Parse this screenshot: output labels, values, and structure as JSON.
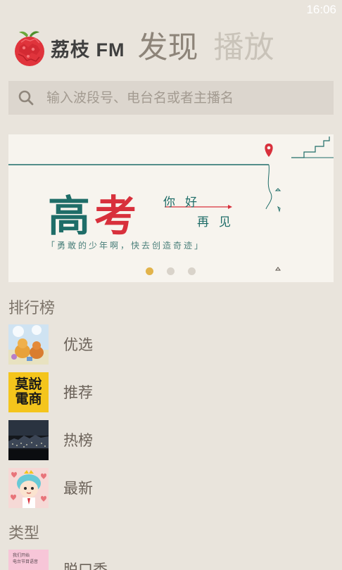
{
  "status_bar": {
    "time": "16:06"
  },
  "header": {
    "logo_text": "荔枝 FM",
    "tabs": [
      {
        "label": "发现",
        "active": true
      },
      {
        "label": "播放",
        "active": false
      }
    ]
  },
  "search": {
    "placeholder": "输入波段号、电台名或者主播名",
    "value": ""
  },
  "banner": {
    "title_part1": "高",
    "title_part2": "考",
    "greeting_line1": "你好",
    "greeting_line2": "再见",
    "motto": "「勇敢的少年啊，快去创造奇迹」",
    "page_count": 3,
    "active_page": 1
  },
  "ranking": {
    "title": "排行榜",
    "items": [
      {
        "label": "优选",
        "icon": "cartoon-bears-thumb"
      },
      {
        "label": "推荐",
        "icon": "yellow-text-thumb"
      },
      {
        "label": "热榜",
        "icon": "night-city-thumb"
      },
      {
        "label": "最新",
        "icon": "cartoon-boy-thumb"
      }
    ]
  },
  "categories": {
    "title": "类型",
    "items": [
      {
        "label": "脱口秀",
        "icon": "pink-card-thumb"
      }
    ]
  },
  "thumb_texts": {
    "yellow": "莫說電商",
    "pink_line1": "我们开始",
    "pink_line2": "电台节目语音"
  },
  "colors": {
    "background": "#e9e4dc",
    "accent_teal": "#1f6d68",
    "accent_red": "#d8303c",
    "dot_active": "#e2b34a"
  }
}
